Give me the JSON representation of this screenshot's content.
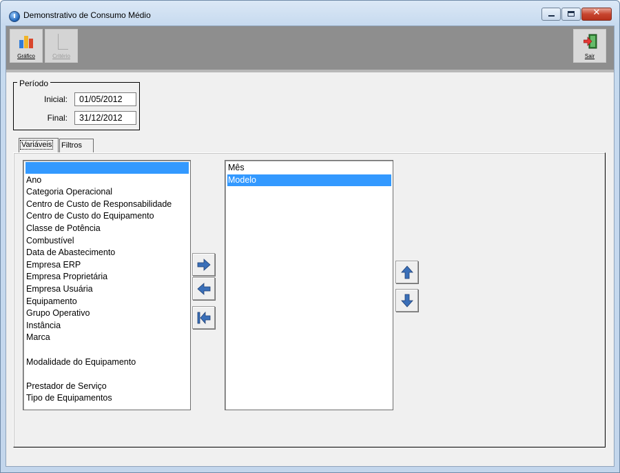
{
  "window": {
    "title": "Demonstrativo de Consumo Médio",
    "controls": {
      "close_glyph": "✕"
    }
  },
  "toolbar": {
    "grafico_label": "Gráfico",
    "criterio_label": "Critério",
    "sair_label": "Sair"
  },
  "periodo": {
    "legend": "Período",
    "inicial_label": "Inicial:",
    "inicial_value": "01/05/2012",
    "final_label": "Final:",
    "final_value": "31/12/2012"
  },
  "tabs": [
    {
      "label": "Variáveis",
      "active": true
    },
    {
      "label": "Filtros",
      "active": false
    }
  ],
  "available_list": {
    "items": [
      "",
      "Ano",
      "Categoria Operacional",
      "Centro de Custo de Responsabilidade",
      "Centro de Custo do Equipamento",
      "Classe de Potência",
      "Combustível",
      "Data de Abastecimento",
      "Empresa ERP",
      "Empresa Proprietária",
      "Empresa Usuária",
      "Equipamento",
      "Grupo Operativo",
      "Instância",
      "Marca",
      "",
      "Modalidade do Equipamento",
      "",
      "Prestador de Serviço",
      "Tipo de Equipamentos"
    ],
    "selected_index": 0
  },
  "selected_list": {
    "items": [
      "Mês",
      "Modelo"
    ],
    "selected_index": 1
  },
  "icons": {
    "move_right": "arrow-right-icon",
    "move_left": "arrow-left-icon",
    "move_all_left": "arrow-left-bar-icon",
    "move_up": "arrow-up-icon",
    "move_down": "arrow-down-icon"
  },
  "colors": {
    "selection": "#3399ff",
    "arrow_blue": "#3a6fb8",
    "toolbar_bg": "#8e8e8e"
  }
}
